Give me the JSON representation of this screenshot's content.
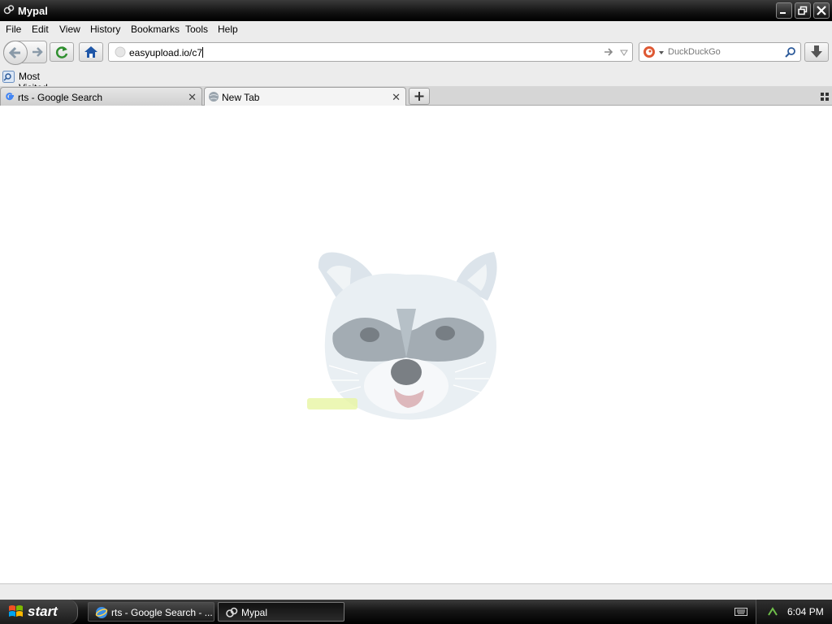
{
  "window": {
    "title": "Mypal"
  },
  "menu": [
    "File",
    "Edit",
    "View",
    "History",
    "Bookmarks",
    "Tools",
    "Help"
  ],
  "urlbar": {
    "value": "easyupload.io/c7"
  },
  "searchbar": {
    "engine": "DuckDuckGo"
  },
  "bookmarks": {
    "most_visited": "Most Visited"
  },
  "tabs": [
    {
      "label": "rts - Google Search",
      "active": false
    },
    {
      "label": "New Tab",
      "active": true
    }
  ],
  "taskbar": {
    "start": "start",
    "tasks": [
      {
        "label": "rts - Google Search - ...",
        "active": false
      },
      {
        "label": "Mypal",
        "active": true
      }
    ],
    "clock": "6:04 PM"
  },
  "icons": {
    "app": "mypal-logo-icon",
    "back": "back-arrow-icon",
    "forward": "forward-arrow-icon",
    "reload": "reload-icon",
    "home": "home-icon",
    "go": "go-arrow-icon",
    "dropdown": "dropdown-icon",
    "search": "magnifier-icon",
    "download": "download-icon",
    "new_tab": "plus-icon",
    "tab_close": "close-icon",
    "tab_grid": "tab-groups-icon"
  },
  "colors": {
    "accent_green": "#2f8f2f",
    "home_blue": "#1f57a8",
    "ddg_orange": "#de5833"
  }
}
